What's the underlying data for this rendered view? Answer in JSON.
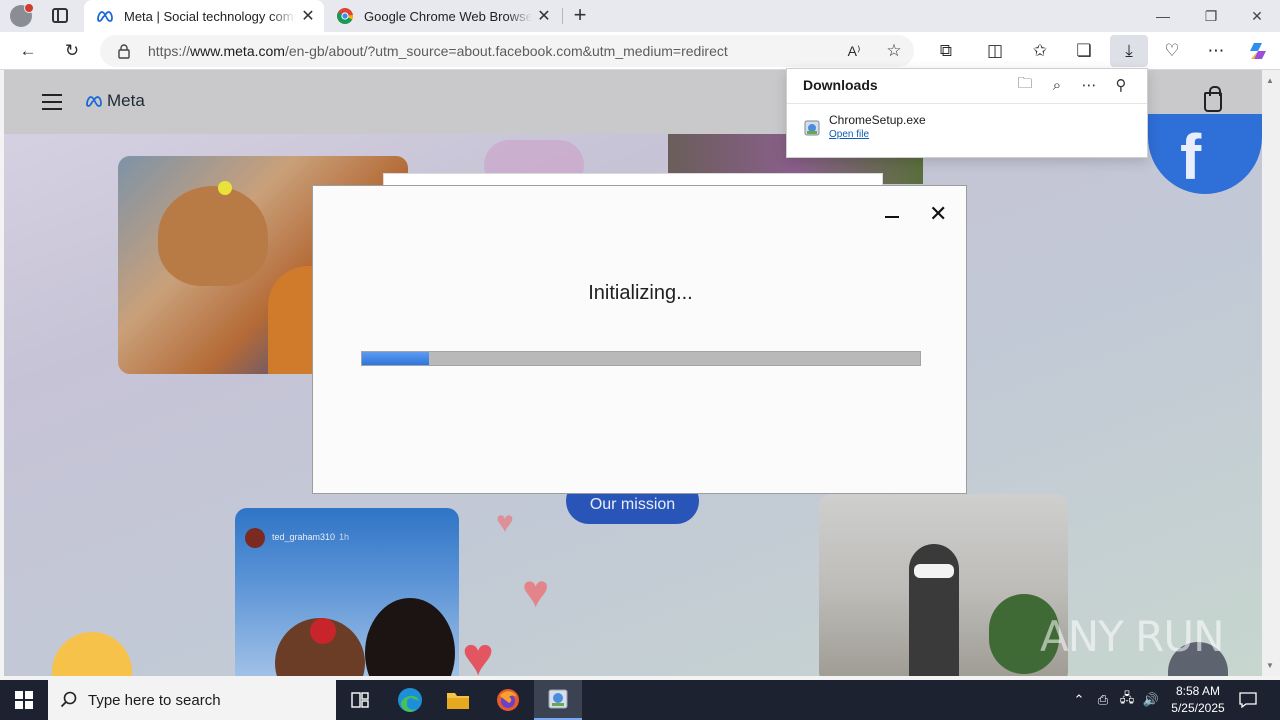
{
  "browser": {
    "tabs": [
      {
        "title": "Meta | Social technology company",
        "favicon": "meta-icon",
        "active": true
      },
      {
        "title": "Google Chrome Web Browser: Fi...",
        "favicon": "chrome-icon",
        "active": false
      }
    ],
    "url_prefix": "https://",
    "url_domain": "www.meta.com",
    "url_path": "/en-gb/about/?utm_source=about.facebook.com&utm_medium=redirect",
    "accent": "#0f5bb5"
  },
  "downloads": {
    "title": "Downloads",
    "item_name": "ChromeSetup.exe",
    "item_action": "Open file"
  },
  "page": {
    "brand": "Meta",
    "mission_button": "Our mission",
    "story_user": "ted_graham310",
    "story_time": "1h"
  },
  "installer": {
    "status": "Initializing...",
    "progress_fraction": 0.12,
    "progress_color": "#3b82e6"
  },
  "watermark": "ANY RUN",
  "taskbar": {
    "search_placeholder": "Type here to search",
    "time": "8:58 AM",
    "date": "5/25/2025"
  }
}
